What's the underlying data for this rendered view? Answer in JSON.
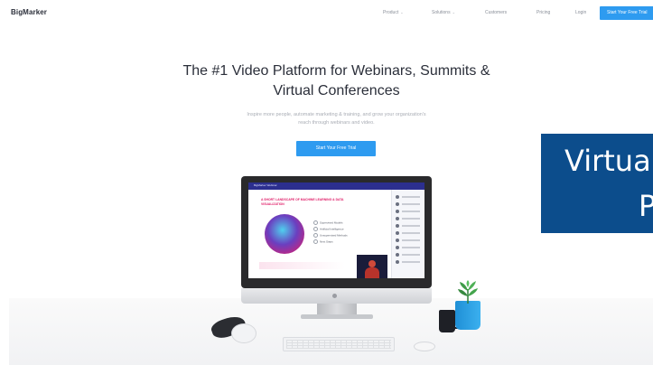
{
  "nav": {
    "logo": "BigMarker",
    "items": [
      {
        "label": "Product",
        "caret": "⌄"
      },
      {
        "label": "Solutions",
        "caret": "⌄"
      },
      {
        "label": "Customers",
        "caret": ""
      },
      {
        "label": "Pricing",
        "caret": ""
      },
      {
        "label": "Login",
        "caret": ""
      }
    ],
    "cta_label": "Start Your Free Trial"
  },
  "hero": {
    "headline_line1": "The #1 Video Platform for Webinars, Summits &",
    "headline_line2": "Virtual Conferences",
    "sub_line1": "Inspire more people, automate marketing & training, and grow your organization's",
    "sub_line2": "reach through webinars and video.",
    "cta_label": "Start Your Free Trial"
  },
  "screen": {
    "title": "BigMarker Webinar",
    "heading": "A SHORT LANDSCAPE OF MACHINE LEARNING & DATA VISUALIZATION",
    "agenda": [
      "Supervised Models",
      "Artificial Intelligence",
      "Unsupervised Methods",
      "Next Steps"
    ]
  },
  "overlay": {
    "line1": "Virtua",
    "line2": "P"
  },
  "colors": {
    "brand_blue": "#2e9bf0",
    "overlay_blue": "#0c4d8c",
    "screen_bar": "#2c2f8f",
    "heading_pink": "#e0206a"
  }
}
